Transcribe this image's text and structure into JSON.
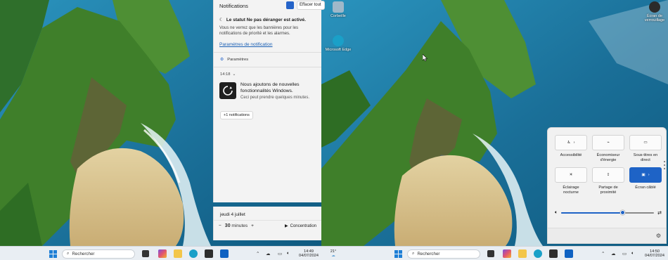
{
  "notification_center": {
    "title": "Notifications",
    "clear_all": "Effacer tout",
    "dnd_title": "Le statut Ne pas déranger est activé.",
    "dnd_text": "Vous ne verrez que les bannières pour les notifications de priorité et les alarmes.",
    "settings_link": "Paramètres de notification",
    "app_group": "Paramètres",
    "time_group": "14:18",
    "notification": {
      "title": "Nous ajoutons de nouvelles fonctionnalités Windows.",
      "body": "Ceci peut prendre quelques minutes."
    },
    "more": "+1 notifications"
  },
  "calendar": {
    "date": "jeudi 4 juillet",
    "minutes_value": "30",
    "minutes_unit": "minutes",
    "minus": "−",
    "plus": "+",
    "focus_label": "Concentration"
  },
  "desktop_icons": [
    {
      "label": "Corbeille",
      "color": "#9fb8c9"
    },
    {
      "label": "Microsoft Edge",
      "color": "#1aa0c8"
    },
    {
      "label": "Écran de verrouillage",
      "color": "#2b2b2b"
    }
  ],
  "quick_settings": {
    "tiles": [
      {
        "label": "Accessibilité",
        "icon": "accessibility-icon",
        "active": false,
        "glyph": "♿"
      },
      {
        "label": "Économiseur d'énergie",
        "icon": "energy-saver-icon",
        "active": false,
        "glyph": "⌁"
      },
      {
        "label": "Sous-titres en direct",
        "icon": "captions-icon",
        "active": false,
        "glyph": "▭"
      },
      {
        "label": "Éclairage nocturne",
        "icon": "night-light-icon",
        "active": false,
        "glyph": "☀"
      },
      {
        "label": "Partage de proximité",
        "icon": "share-icon",
        "active": false,
        "glyph": "⇪"
      },
      {
        "label": "Écran câblé",
        "icon": "cast-icon",
        "active": true,
        "glyph": "▣"
      }
    ],
    "volume_percent": 66,
    "chevron": "›"
  },
  "taskbar_left": {
    "search_placeholder": "Rechercher",
    "weather_temp": "21°",
    "time": "14:49",
    "date": "04/07/2024"
  },
  "taskbar_right": {
    "search_placeholder": "Rechercher",
    "time": "14:50",
    "date": "04/07/2024"
  },
  "colors": {
    "accent": "#1e63c6",
    "sea": "#1c7fa6",
    "cliff_green": "#3f7f2a",
    "sand": "#d9c28f"
  }
}
